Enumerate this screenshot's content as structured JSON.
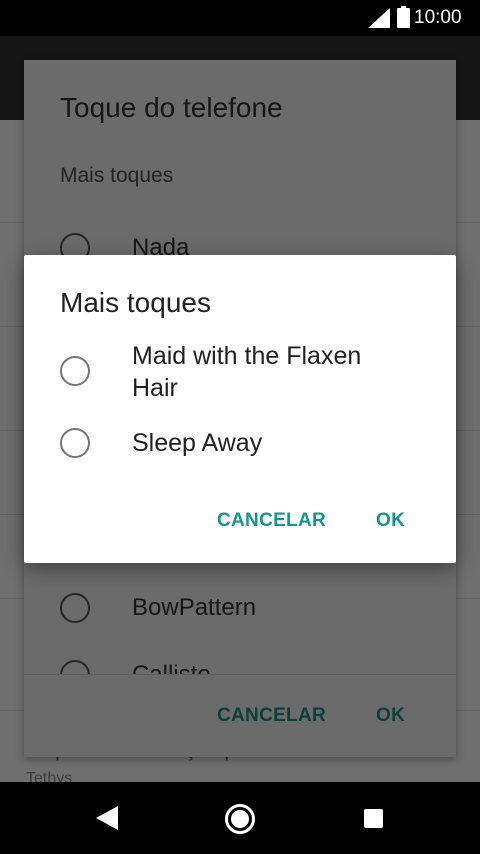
{
  "status_bar": {
    "time": "10:00",
    "icons": [
      "signal-icon",
      "battery-icon"
    ]
  },
  "background_setting": {
    "title": "Toque de notificação predefinido",
    "subtitle": "Tethys"
  },
  "underlying_dialog": {
    "title": "Toque do telefone",
    "section_label": "Mais toques",
    "visible_options": [
      "Nada",
      "BowPattern",
      "Callisto"
    ],
    "cancel_label": "CANCELAR",
    "ok_label": "OK"
  },
  "dialog": {
    "title": "Mais toques",
    "options": [
      {
        "label": "Maid with the Flaxen Hair",
        "selected": false
      },
      {
        "label": "Sleep Away",
        "selected": false
      }
    ],
    "cancel_label": "CANCELAR",
    "ok_label": "OK",
    "accent_color": "#0f9a8a"
  },
  "nav_bar": {
    "icons": [
      "back-icon",
      "home-icon",
      "recents-icon"
    ]
  }
}
